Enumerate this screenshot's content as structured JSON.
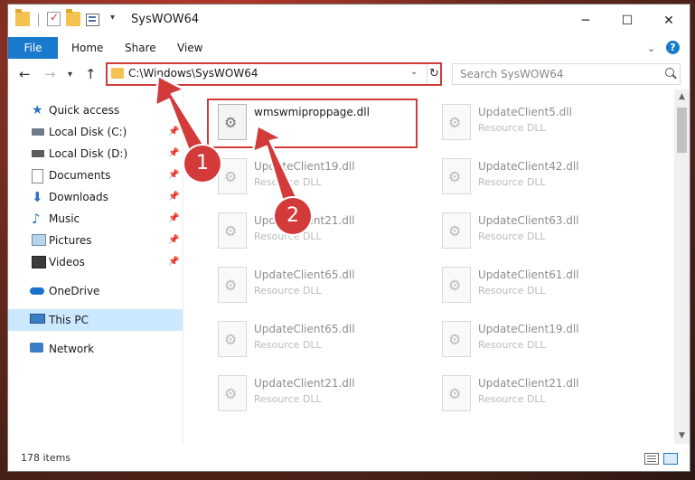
{
  "window": {
    "title": "SysWOW64",
    "controls": {
      "minimize": "─",
      "maximize": "☐",
      "close": "✕"
    }
  },
  "ribbon": {
    "file": "File",
    "tabs": [
      "Home",
      "Share",
      "View"
    ],
    "help": "?"
  },
  "address": {
    "path": "C:\\Windows\\SysWOW64",
    "search_placeholder": "Search SysWOW64"
  },
  "nav": {
    "items": [
      {
        "label": "Quick access",
        "icon": "star-icon",
        "pinned": false,
        "selected": false
      },
      {
        "label": "Local Disk (C:)",
        "icon": "disk-icon",
        "pinned": true,
        "selected": false
      },
      {
        "label": "Local Disk (D:)",
        "icon": "disk-icon",
        "pinned": true,
        "selected": false
      },
      {
        "label": "Documents",
        "icon": "documents-icon",
        "pinned": true,
        "selected": false
      },
      {
        "label": "Downloads",
        "icon": "downloads-icon",
        "pinned": true,
        "selected": false
      },
      {
        "label": "Music",
        "icon": "music-icon",
        "pinned": true,
        "selected": false
      },
      {
        "label": "Pictures",
        "icon": "pictures-icon",
        "pinned": true,
        "selected": false
      },
      {
        "label": "Videos",
        "icon": "videos-icon",
        "pinned": true,
        "selected": false
      },
      {
        "label": "OneDrive",
        "icon": "onedrive-icon",
        "pinned": false,
        "selected": false
      },
      {
        "label": "This PC",
        "icon": "this-pc-icon",
        "pinned": false,
        "selected": true
      },
      {
        "label": "Network",
        "icon": "network-icon",
        "pinned": false,
        "selected": false
      }
    ]
  },
  "files": [
    {
      "name": "wmswmiproppage.dll",
      "type": "",
      "highlighted": true
    },
    {
      "name": "UpdateClient5.dll",
      "type": "Resource DLL"
    },
    {
      "name": "UpdateClient19.dll",
      "type": "Resource DLL"
    },
    {
      "name": "UpdateClient42.dll",
      "type": "Resource DLL"
    },
    {
      "name": "UpdateClient21.dll",
      "type": "Resource DLL"
    },
    {
      "name": "UpdateClient63.dll",
      "type": "Resource DLL"
    },
    {
      "name": "UpdateClient65.dll",
      "type": "Resource DLL"
    },
    {
      "name": "UpdateClient61.dll",
      "type": "Resource DLL"
    },
    {
      "name": "UpdateClient65.dll",
      "type": "Resource DLL"
    },
    {
      "name": "UpdateClient19.dll",
      "type": "Resource DLL"
    },
    {
      "name": "UpdateClient21.dll",
      "type": "Resource DLL"
    },
    {
      "name": "UpdateClient21.dll",
      "type": "Resource DLL"
    }
  ],
  "status": {
    "items": "178 items"
  },
  "annotations": {
    "step1": "1",
    "step2": "2"
  },
  "colors": {
    "accent": "#1979ca",
    "highlight": "#d33b3b",
    "selected": "#cce8ff"
  }
}
